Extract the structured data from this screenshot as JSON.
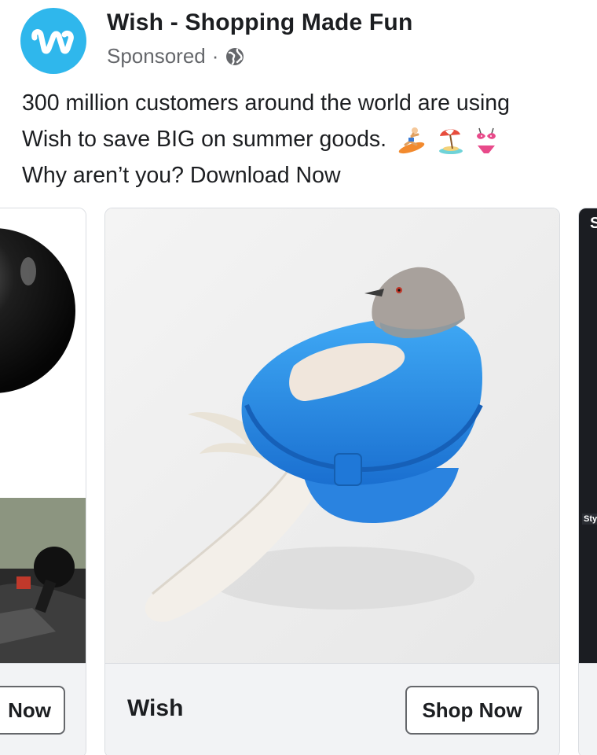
{
  "header": {
    "page_name": "Wish - Shopping Made Fun",
    "sponsored_label": "Sponsored",
    "separator": "·",
    "logo_letter": "w",
    "brand_color": "#2fb7ec",
    "globe_icon": "globe-icon"
  },
  "post": {
    "line1": "300 million customers around the world are using",
    "line2": "Wish to save BIG on summer goods.",
    "line2_emojis": [
      "surfer-emoji",
      "beach-umbrella-emoji",
      "bikini-emoji"
    ],
    "line3": "Why aren’t you? Download Now"
  },
  "carousel": {
    "left_card": {
      "cta_label": "Now"
    },
    "main_card": {
      "title": "Wish",
      "cta_label": "Shop Now",
      "image": "pigeon-in-blue-plastic-holder"
    },
    "right_card": {
      "top_letter": "S",
      "label": "Sty"
    }
  }
}
